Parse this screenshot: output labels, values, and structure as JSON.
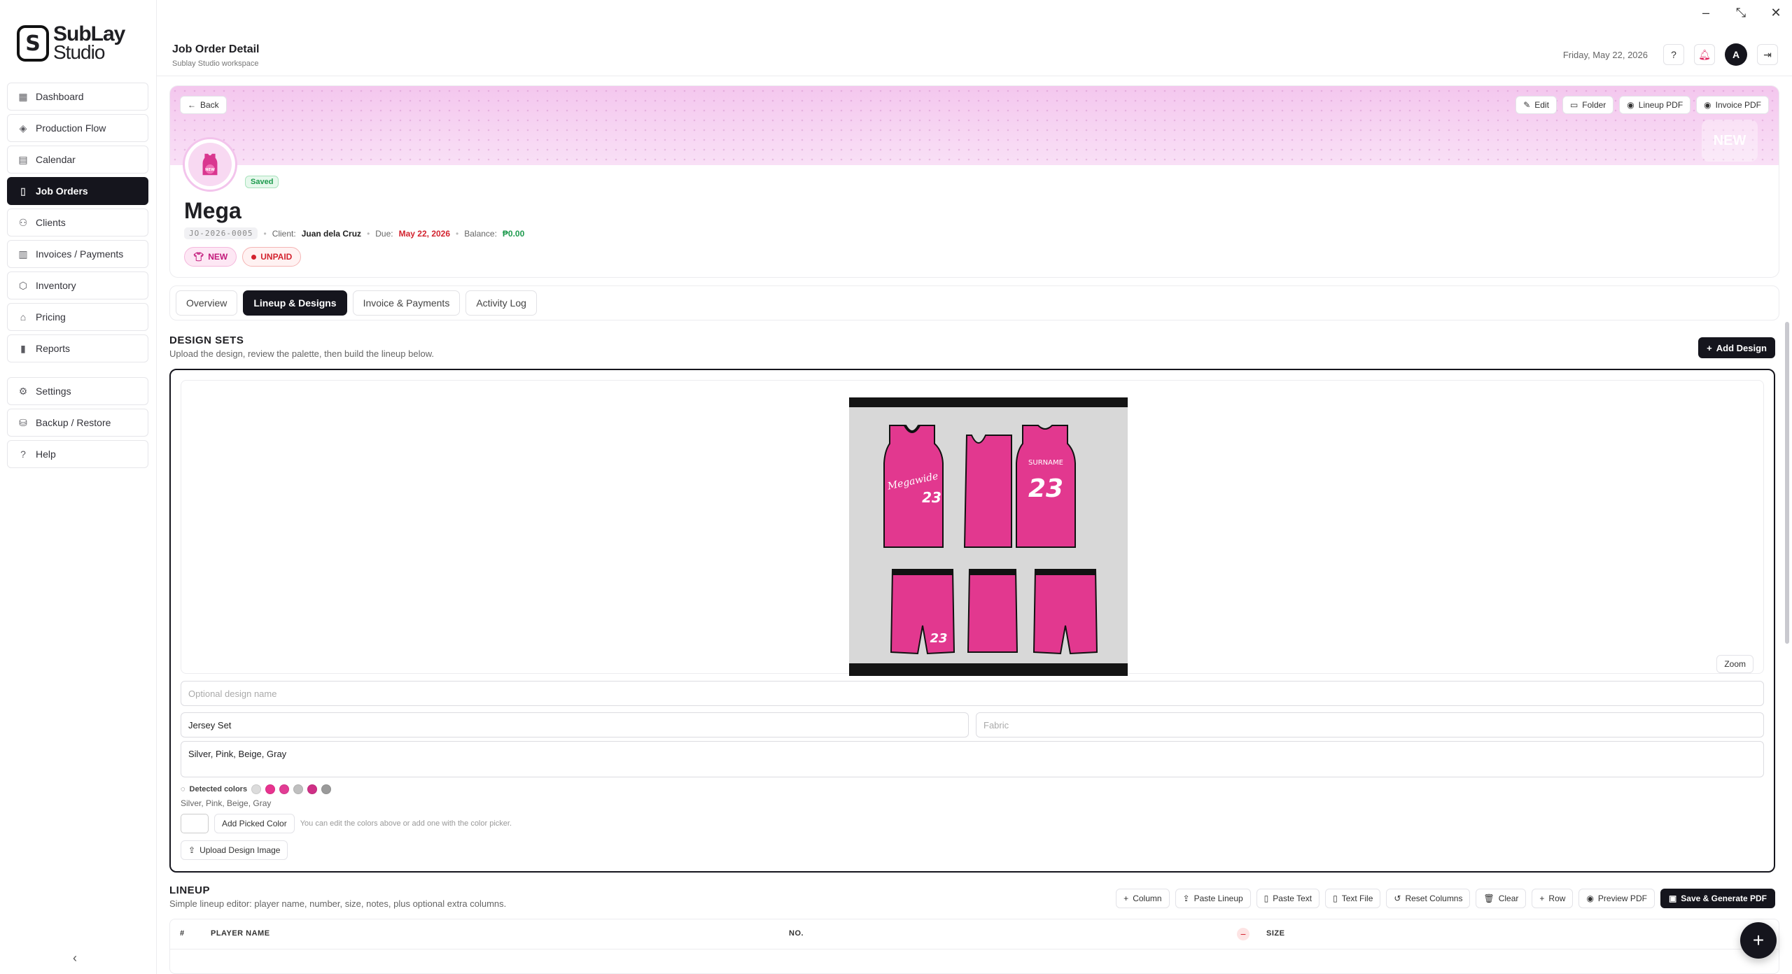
{
  "window": {
    "minimize": "–",
    "restore": "⤡",
    "close": "✕"
  },
  "brand": {
    "mark": "S",
    "line1": "SubLay",
    "line2": "Studio"
  },
  "sidebar": {
    "items": [
      {
        "label": "Dashboard",
        "icon": "grid-icon"
      },
      {
        "label": "Production Flow",
        "icon": "layers-icon"
      },
      {
        "label": "Calendar",
        "icon": "calendar-icon"
      },
      {
        "label": "Job Orders",
        "icon": "document-icon",
        "active": true
      },
      {
        "label": "Clients",
        "icon": "users-icon"
      },
      {
        "label": "Invoices / Payments",
        "icon": "invoice-icon"
      },
      {
        "label": "Inventory",
        "icon": "box-icon"
      },
      {
        "label": "Pricing",
        "icon": "tag-icon"
      },
      {
        "label": "Reports",
        "icon": "bar-chart-icon"
      },
      {
        "label": "Settings",
        "icon": "gear-icon"
      },
      {
        "label": "Backup / Restore",
        "icon": "database-icon"
      },
      {
        "label": "Help",
        "icon": "help-icon"
      }
    ],
    "collapse": "‹"
  },
  "header": {
    "title": "Job Order Detail",
    "subtitle": "Sublay Studio workspace",
    "date": "Friday, May 22, 2026",
    "avatar": "A"
  },
  "job": {
    "back": "Back",
    "actions": [
      "Edit",
      "Folder",
      "Lineup PDF",
      "Invoice PDF"
    ],
    "saved": "Saved",
    "name": "Mega",
    "code": "JO-2026-0005",
    "client_label": "Client:",
    "client": "Juan dela Cruz",
    "due_label": "Due:",
    "due": "May 22, 2026",
    "balance_label": "Balance:",
    "balance": "₱0.00",
    "status_new": "NEW",
    "status_paid": "UNPAID",
    "avatar_badge": "NEW",
    "banner_badge": "NEW"
  },
  "tabs": [
    "Overview",
    "Lineup & Designs",
    "Invoice & Payments",
    "Activity Log"
  ],
  "design_sets": {
    "title": "DESIGN SETS",
    "subtitle": "Upload the design, review the palette, then build the lineup below.",
    "add_button": "Add Design",
    "zoom": "Zoom",
    "name_placeholder": "Optional design name",
    "type_value": "Jersey Set",
    "fabric_placeholder": "Fabric",
    "colors_value": "Silver, Pink, Beige, Gray",
    "detected_label": "Detected colors",
    "detected_swatches": [
      "#dcdcdc",
      "#e8338f",
      "#e23c94",
      "#bfbfbf",
      "#cf2f86",
      "#9a9a9a"
    ],
    "detected_text": "Silver, Pink, Beige, Gray",
    "picked_color": "#1e7a3c",
    "add_picked": "Add Picked Color",
    "hint": "You can edit the colors above or add one with the color picker.",
    "upload": "Upload Design Image",
    "jersey_name": "Megawide",
    "jersey_number": "23",
    "jersey_surname": "SURNAME"
  },
  "lineup": {
    "title": "LINEUP",
    "subtitle": "Simple lineup editor: player name, number, size, notes, plus optional extra columns.",
    "actions": [
      "Column",
      "Paste Lineup",
      "Paste Text",
      "Text File",
      "Reset Columns",
      "Clear",
      "Row",
      "Preview PDF"
    ],
    "save": "Save & Generate PDF",
    "columns": [
      "#",
      "PLAYER NAME",
      "NO.",
      "SIZE"
    ]
  },
  "fab": "+"
}
